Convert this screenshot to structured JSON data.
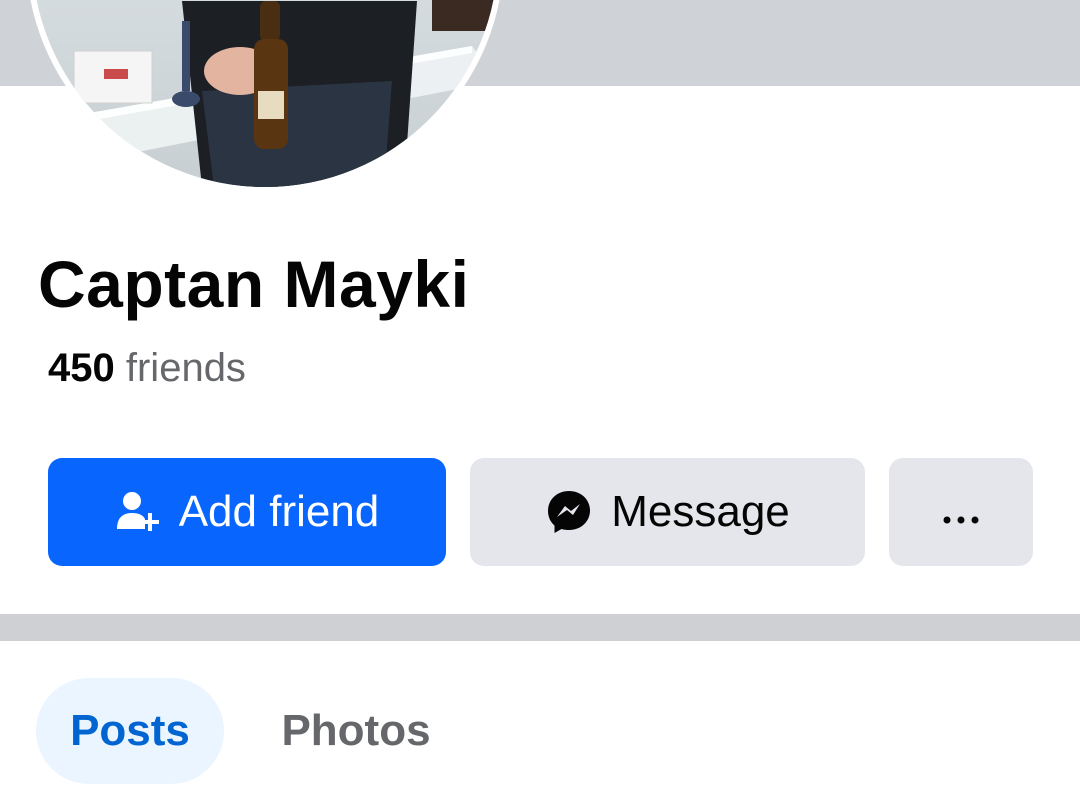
{
  "profile": {
    "name": "Captan Mayki",
    "friends_count": "450",
    "friends_label": "friends"
  },
  "actions": {
    "add_friend": "Add friend",
    "message": "Message",
    "more": "···"
  },
  "tabs": [
    {
      "label": "Posts",
      "active": true
    },
    {
      "label": "Photos",
      "active": false
    }
  ],
  "colors": {
    "primary": "#0866ff",
    "secondary_button": "#e4e6eb",
    "active_tab_bg": "#ebf5ff",
    "active_tab_text": "#0064d1",
    "muted_text": "#65676b"
  }
}
